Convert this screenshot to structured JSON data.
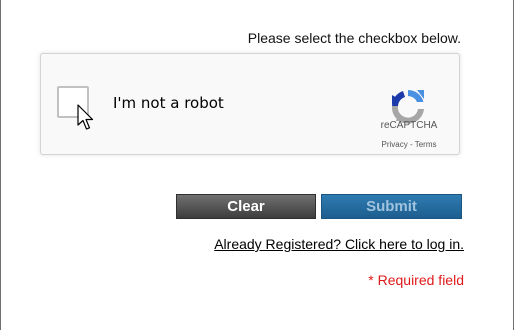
{
  "form": {
    "instruction": "Please select the checkbox below.",
    "recaptcha": {
      "label": "I'm not a robot",
      "brand": "reCAPTCHA",
      "privacy_link": "Privacy",
      "separator": " - ",
      "terms_link": "Terms",
      "checked": false
    },
    "buttons": {
      "clear_label": "Clear",
      "submit_label": "Submit"
    },
    "login_link": "Already Registered? Click here to log in.",
    "required_note": "* Required field"
  },
  "colors": {
    "clear_button": "#4a4a4a",
    "submit_button": "#2570a6",
    "required_text": "#e01a1a",
    "recaptcha_blue": "#1c3aa9",
    "recaptcha_lightblue": "#4a90e2"
  },
  "icons": [
    "recaptcha-logo-icon",
    "mouse-cursor-icon"
  ]
}
